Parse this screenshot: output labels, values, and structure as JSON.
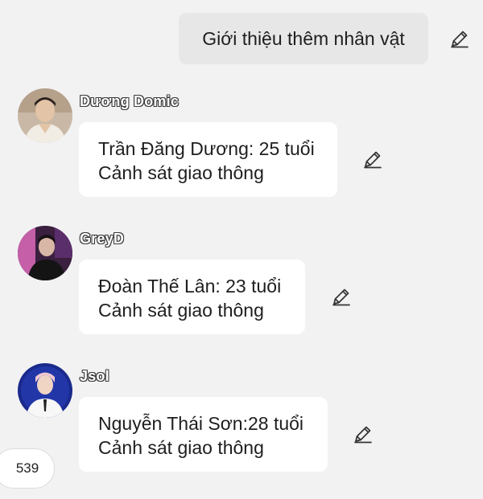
{
  "user_message": {
    "text": "Giới thiệu thêm nhân vật",
    "edit_icon": "pencil-icon"
  },
  "messages": [
    {
      "author": "Dương Domic",
      "lines": [
        "Trần Đăng Dương: 25 tuổi",
        "Cảnh sát giao thông"
      ],
      "edit_icon": "pencil-icon"
    },
    {
      "author": "GreyD",
      "lines": [
        "Đoàn Thế Lân: 23 tuổi",
        "Cảnh sát giao thông"
      ],
      "edit_icon": "pencil-icon"
    },
    {
      "author": "Jsol",
      "lines": [
        "Nguyễn Thái Sơn:28 tuổi",
        "Cảnh sát giao thông"
      ],
      "edit_icon": "pencil-icon"
    }
  ],
  "counter": "539",
  "colors": {
    "background": "#f2f2f3",
    "user_bubble": "#e7e7e8",
    "bot_bubble": "#ffffff",
    "text": "#1e1e1e"
  }
}
